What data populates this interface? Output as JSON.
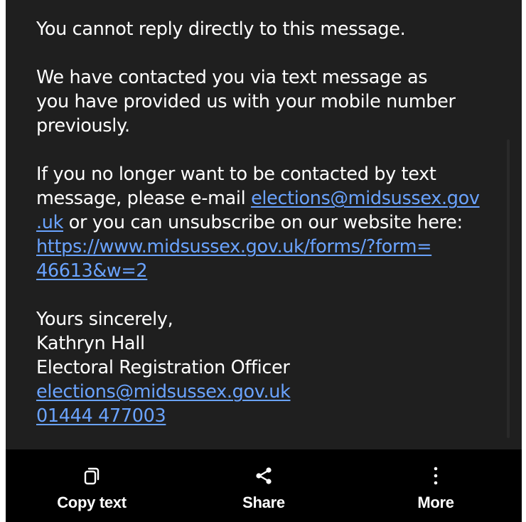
{
  "message": {
    "para1": [
      "You cannot reply directly to this message."
    ],
    "para2": [
      "We have contacted you via text message as",
      "you have provided us with your mobile number",
      "previously."
    ],
    "para3": {
      "line1": "If you no longer want to be contacted by text",
      "line2_text": "message, please e-mail ",
      "line2_link": "elections@midsussex.gov",
      "line3_link": ".uk",
      "line3_text": " or you can unsubscribe on our website here:",
      "line4_link": "https://www.midsussex.gov.uk/forms/?form=",
      "line5_link": "46613&w=2"
    },
    "signoff": {
      "greeting": "Yours sincerely,",
      "name": "Kathryn Hall",
      "title": "Electoral Registration Officer",
      "email_link": "elections@midsussex.gov.uk",
      "phone_link": "01444 477003"
    }
  },
  "toolbar": {
    "copy_label": "Copy text",
    "share_label": "Share",
    "more_label": "More",
    "copy_icon": "copy-icon",
    "share_icon": "share-icon",
    "more_icon": "more-vertical-icon"
  },
  "colors": {
    "background": "#1f1f1f",
    "toolbar": "#000000",
    "text": "#ffffff",
    "link": "#6aa3ff"
  }
}
